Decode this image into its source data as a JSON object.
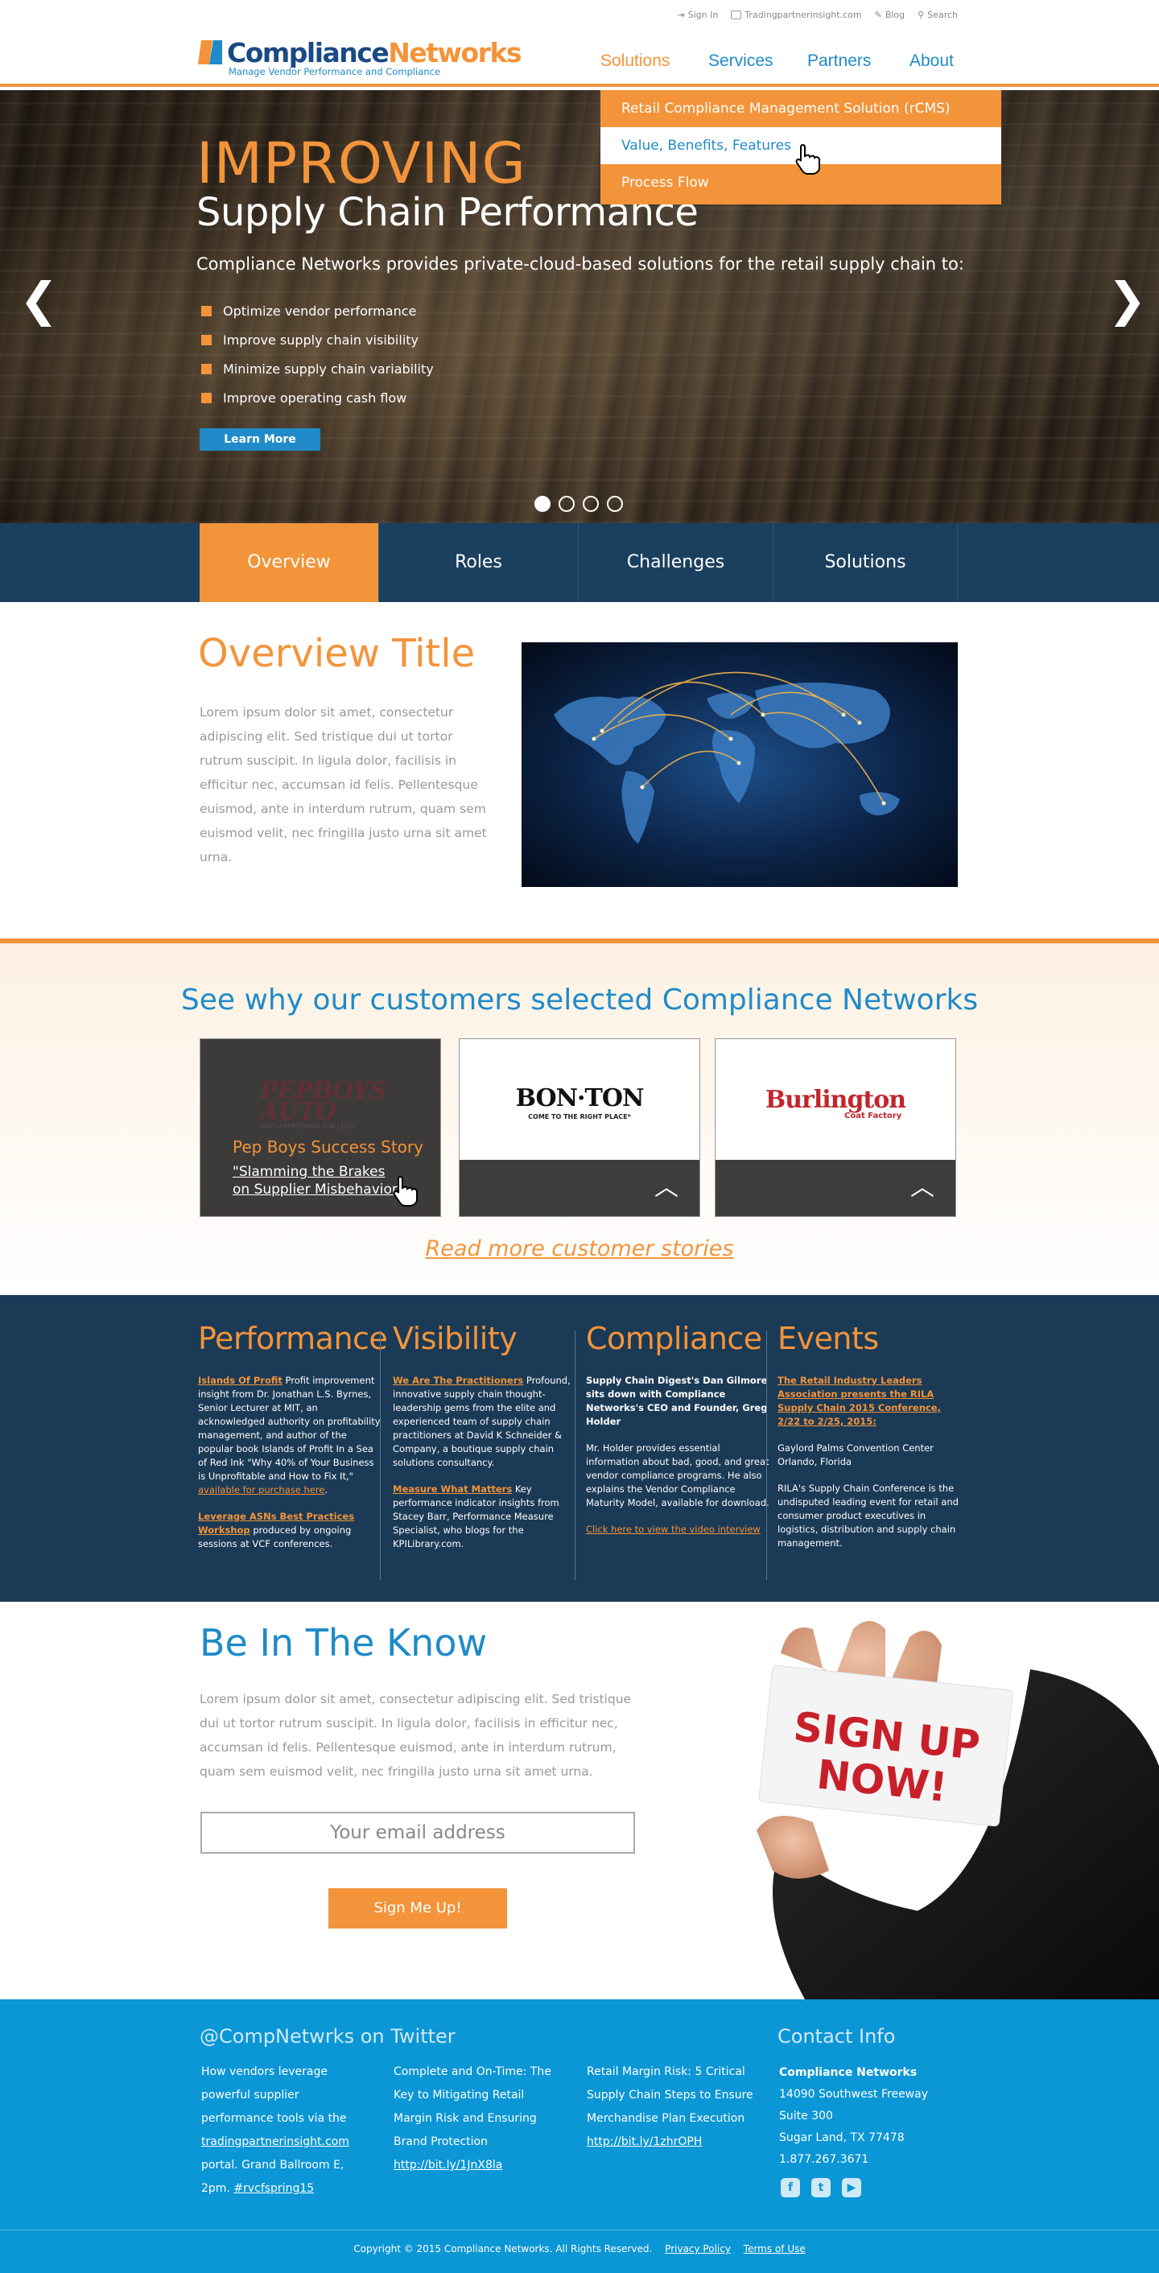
{
  "header": {
    "logo": {
      "part1": "Compliance",
      "part2": "Networks",
      "tagline": "Manage Vendor Performance and Compliance"
    },
    "utility": [
      {
        "icon": "sign-in-icon",
        "label": "Sign In"
      },
      {
        "icon": "monitor-icon",
        "label": "Tradingpartnerinsight.com"
      },
      {
        "icon": "pencil-icon",
        "label": "Blog"
      },
      {
        "icon": "search-icon",
        "label": "Search"
      }
    ],
    "nav": [
      "Solutions",
      "Services",
      "Partners",
      "About"
    ],
    "dropdown": [
      "Retail Compliance Management Solution (rCMS)",
      "Value, Benefits, Features",
      "Process Flow"
    ]
  },
  "hero": {
    "h1": "IMPROVING",
    "h2": "Supply Chain Performance",
    "intro": "Compliance Networks provides private-cloud-based solutions for the retail supply chain to:",
    "bullets": [
      "Optimize vendor performance",
      "Improve supply chain visibility",
      "Minimize supply chain variability",
      "Improve operating cash flow"
    ],
    "button": "Learn More",
    "prev": "❮",
    "next": "❯"
  },
  "tabs": [
    "Overview",
    "Roles",
    "Challenges",
    "Solutions"
  ],
  "overview": {
    "title": "Overview Title",
    "body": "Lorem ipsum dolor sit amet, consectetur adipiscing elit. Sed tristique dui ut tortor rutrum suscipit. In ligula dolor, facilisis in efficitur nec, accumsan id felis. Pellentesque euismod, ante in interdum rutrum, quam sem euismod velit, nec fringilla justo urna sit amet urna."
  },
  "customers": {
    "title": "See why our customers selected Compliance Networks",
    "pepboys": {
      "logo": "PEPBOYS AUTO",
      "logo_line1": "PEPBOYS",
      "logo_line2": "AUTO",
      "logo_tag": "BOYS EVERYTHING FOR LESS.",
      "title": "Pep Boys Success Story",
      "quote_line1": "\"Slamming the Brakes",
      "quote_line2": "on Supplier Misbehavior\""
    },
    "bonton": {
      "logo": "BON·TON",
      "tag": "COME TO THE RIGHT PLACE*"
    },
    "burlington": {
      "logo": "Burlington",
      "tag": "Coat Factory"
    },
    "read_more": "Read more customer stories"
  },
  "info": {
    "performance": {
      "title": "Performance",
      "p1_link": "Islands Of Profit",
      "p1_text": " Profit improvement insight from Dr. Jonathan L.S. Byrnes, Senior Lecturer at MIT, an acknowledged authority on profitability management, and author of the popular book Islands of Profit In a Sea of Red Ink \"Why 40% of Your Business is Unprofitable and How to Fix It,\" ",
      "p1_link2": "available for purchase here",
      "p2_link": "Leverage ASNs Best Practices Workshop",
      "p2_text": " produced by ongoing sessions at VCF conferences."
    },
    "visibility": {
      "title": "Visibility",
      "p1_link": "We Are The Practitioners",
      "p1_text": " Profound, innovative supply chain thought-leadership gems from the elite and experienced team of supply chain practitioners at David K Schneider & Company, a boutique supply chain solutions consultancy.",
      "p2_link": "Measure What Matters",
      "p2_text": " Key performance indicator insights from Stacey Barr, Performance Measure Specialist, who blogs for the KPILibrary.com."
    },
    "compliance": {
      "title": "Compliance",
      "p1_bold": "Supply Chain Digest's Dan Gilmore sits down with Compliance Networks's CEO and Founder, Greg Holder",
      "p2": "Mr. Holder provides essential information about bad, good, and great vendor compliance programs. He also explains the Vendor Compliance Maturity Model, available for download.",
      "p3_link": "Click here to view the video interview"
    },
    "events": {
      "title": "Events",
      "p1_link": "The Retail Industry Leaders Association presents the RILA Supply Chain 2015 Conference, 2/22 to 2/25, 2015:",
      "p2": "Gaylord Palms Convention Center Orlando, Florida",
      "p3": "RILA's Supply Chain Conference is the undisputed leading event for retail and consumer product executives in logistics, distribution and supply chain management."
    }
  },
  "know": {
    "title": "Be In The Know",
    "body": "Lorem ipsum dolor sit amet, consectetur adipiscing elit. Sed tristique dui ut tortor rutrum suscipit. In ligula dolor, facilisis in efficitur nec, accumsan id felis. Pellentesque euismod, ante in interdum rutrum, quam sem euismod velit, nec fringilla justo urna sit amet urna.",
    "placeholder": "Your email address",
    "button": "Sign Me Up!",
    "card_line1": "SIGN UP",
    "card_line2": "NOW!"
  },
  "footer": {
    "twitter_title": "@CompNetwrks on Twitter",
    "tweets": [
      {
        "t1": "How vendors leverage powerful supplier performance tools via the ",
        "link": "tradingpartnerinsight.com",
        "t2": " portal. Grand Ballroom E, 2pm. ",
        "tag": "#rvcfspring15"
      },
      {
        "t1": "Complete and On-Time: The Key to Mitigating Retail Margin Risk and Ensuring Brand Protection ",
        "link": "http://bit.ly/1JnX8la"
      },
      {
        "t1": "Retail Margin Risk: 5 Critical Supply Chain Steps to Ensure Merchandise Plan Execution ",
        "link": "http://bit.ly/1zhrOPH"
      }
    ],
    "contact_title": "Contact Info",
    "company": "Compliance Networks",
    "address1": "14090 Southwest Freeway",
    "address2": "Suite 300",
    "address3": "Sugar Land, TX  77478",
    "phone": "1.877.267.3671",
    "social": [
      "facebook-icon",
      "twitter-icon",
      "youtube-icon"
    ],
    "copyright": "Copyright © 2015 Compliance Networks. All Rights Reserved.",
    "privacy": "Privacy Policy",
    "terms": "Terms of Use"
  },
  "colors": {
    "orange": "#f3943a",
    "blue": "#1f8bc8",
    "navy": "#1b405f",
    "footer_blue": "#0b96d5"
  }
}
